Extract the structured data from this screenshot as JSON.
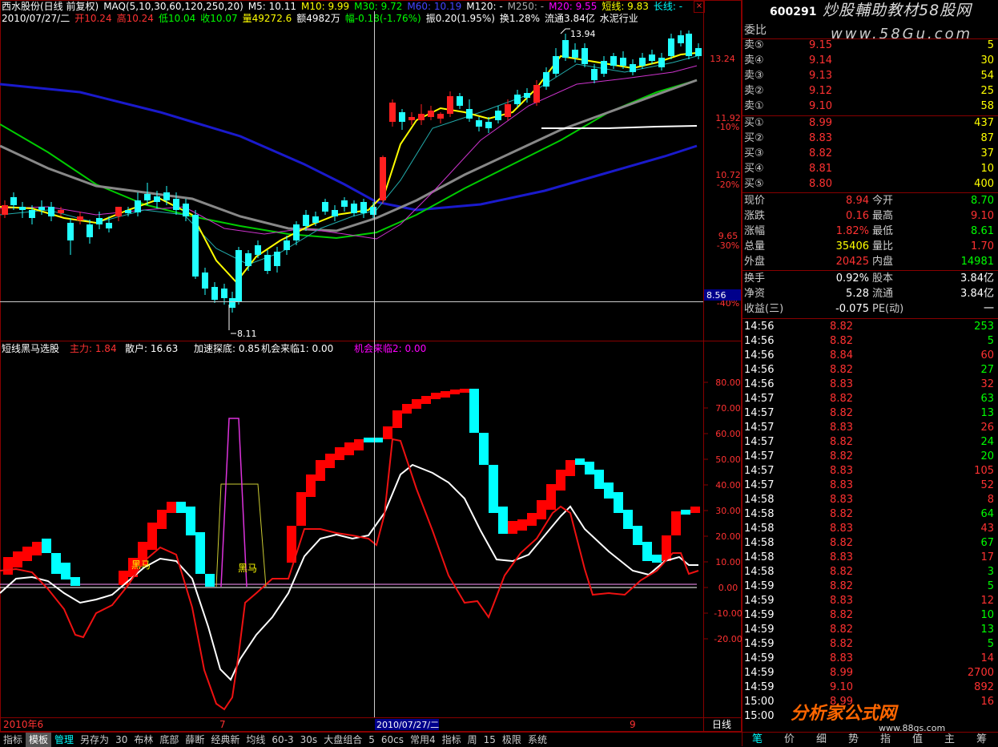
{
  "price_header": {
    "title": "西水股份(日线 前复权)",
    "maq": "MAQ(5,10,30,60,120,250,20)",
    "ma5": "M5: 10.11",
    "ma10": "M10: 9.99",
    "ma30": "M30: 9.72",
    "ma60": "M60: 10.19",
    "ma120": "M120: -",
    "ma250": "M250: -",
    "ma20": "M20: 9.55",
    "short_line": "短线: 9.83",
    "long_line": "长线: -",
    "date": "2010/07/27/二",
    "open": "开10.24",
    "high": "高10.24",
    "low": "低10.04",
    "close": "收10.07",
    "volume": "量49272.6",
    "amount": "额4982万",
    "change": "幅-0.18(-1.76%)",
    "amplitude": "振0.20(1.95%)",
    "turnover": "换1.28%",
    "float_cap": "流通3.84亿",
    "industry": "水泥行业"
  },
  "price_axis": {
    "labels": [
      "13.24",
      "11.92",
      "10.72",
      "9.65"
    ],
    "pct_labels": [
      "-10%",
      "-20%",
      "-30%",
      "-40%"
    ],
    "crosshair_price": "8.56"
  },
  "price_annotations": {
    "high": "13.94",
    "low": "8.11"
  },
  "indicator_header": {
    "name": "短线黑马选股",
    "main_force": "主力: 1.84",
    "retail": "散户: 16.63",
    "accel": "加速探底: 0.85",
    "chance1": "机会来临1: 0.00",
    "chance2": "机会来临2: 0.00"
  },
  "indicator_axis": {
    "labels": [
      "80.00",
      "70.00",
      "60.00",
      "50.00",
      "40.00",
      "30.00",
      "20.00",
      "10.00",
      "0.00",
      "-10.00",
      "-20.00"
    ]
  },
  "indicator_labels": {
    "heima1": "黑马",
    "heima2": "黑马"
  },
  "date_axis": {
    "left": "2010年6",
    "month7": "7",
    "cursor_date": "2010/07/27/二",
    "month9": "9",
    "period": "日线"
  },
  "toolbar": {
    "items": [
      "指标",
      "模板",
      "管理",
      "另存为",
      "30",
      "布林",
      "底部",
      "薛断",
      "经典新",
      "均线",
      "60-3",
      "30s",
      "大盘组合",
      "5",
      "60cs",
      "常用4",
      "指标",
      "周",
      "15",
      "极限",
      "系统"
    ]
  },
  "quote": {
    "code": "600291",
    "watermark1": "炒股輔助教材58股网",
    "watermark2": "www.58Gu.com",
    "weibi": "委比",
    "sells": [
      {
        "label": "卖⑤",
        "price": "9.15",
        "vol": "5"
      },
      {
        "label": "卖④",
        "price": "9.14",
        "vol": "30"
      },
      {
        "label": "卖③",
        "price": "9.13",
        "vol": "54"
      },
      {
        "label": "卖②",
        "price": "9.12",
        "vol": "25"
      },
      {
        "label": "卖①",
        "price": "9.10",
        "vol": "58"
      }
    ],
    "buys": [
      {
        "label": "买①",
        "price": "8.99",
        "vol": "437"
      },
      {
        "label": "买②",
        "price": "8.83",
        "vol": "87"
      },
      {
        "label": "买③",
        "price": "8.82",
        "vol": "37"
      },
      {
        "label": "买④",
        "price": "8.81",
        "vol": "10"
      },
      {
        "label": "买⑤",
        "price": "8.80",
        "vol": "400"
      }
    ],
    "stats_left": [
      {
        "label": "现价",
        "value": "8.94"
      },
      {
        "label": "涨跌",
        "value": "0.16"
      },
      {
        "label": "涨幅",
        "value": "1.82%"
      },
      {
        "label": "总量",
        "value": "35406"
      },
      {
        "label": "外盘",
        "value": "20425"
      }
    ],
    "stats_right": [
      {
        "label": "今开",
        "value": "8.70"
      },
      {
        "label": "最高",
        "value": "9.10"
      },
      {
        "label": "最低",
        "value": "8.61"
      },
      {
        "label": "量比",
        "value": "1.70"
      },
      {
        "label": "内盘",
        "value": "14981"
      }
    ],
    "fund": [
      {
        "l1": "换手",
        "v1": "0.92%",
        "l2": "股本",
        "v2": "3.84亿"
      },
      {
        "l1": "净资",
        "v1": "5.28",
        "l2": "流通",
        "v2": "3.84亿"
      },
      {
        "l1": "收益(三)",
        "v1": "-0.075",
        "l2": "PE(动)",
        "v2": "一"
      }
    ],
    "ticks": [
      [
        "14:56",
        "8.82",
        "253"
      ],
      [
        "14:56",
        "8.82",
        "5"
      ],
      [
        "14:56",
        "8.84",
        "60"
      ],
      [
        "14:56",
        "8.82",
        "27"
      ],
      [
        "14:56",
        "8.83",
        "32"
      ],
      [
        "14:57",
        "8.82",
        "63"
      ],
      [
        "14:57",
        "8.82",
        "13"
      ],
      [
        "14:57",
        "8.83",
        "26"
      ],
      [
        "14:57",
        "8.82",
        "24"
      ],
      [
        "14:57",
        "8.82",
        "20"
      ],
      [
        "14:57",
        "8.83",
        "105"
      ],
      [
        "14:57",
        "8.83",
        "52"
      ],
      [
        "14:58",
        "8.83",
        "8"
      ],
      [
        "14:58",
        "8.82",
        "64"
      ],
      [
        "14:58",
        "8.83",
        "43"
      ],
      [
        "14:58",
        "8.82",
        "67"
      ],
      [
        "14:58",
        "8.83",
        "17"
      ],
      [
        "14:58",
        "8.82",
        "3"
      ],
      [
        "14:59",
        "8.82",
        "5"
      ],
      [
        "14:59",
        "8.83",
        "12"
      ],
      [
        "14:59",
        "8.82",
        "10"
      ],
      [
        "14:59",
        "8.82",
        "13"
      ],
      [
        "14:59",
        "8.82",
        "5"
      ],
      [
        "14:59",
        "8.83",
        "14"
      ],
      [
        "14:59",
        "8.99",
        "2700"
      ],
      [
        "14:59",
        "9.10",
        "892"
      ],
      [
        "15:00",
        "8.99",
        "16"
      ],
      [
        "15:00",
        "",
        ""
      ]
    ],
    "tabs": [
      "笔",
      "价",
      "细",
      "势",
      "指",
      "值",
      "主",
      "筹"
    ],
    "watermark3": "分析家公式网",
    "watermark4": "www.88gs.com"
  }
}
